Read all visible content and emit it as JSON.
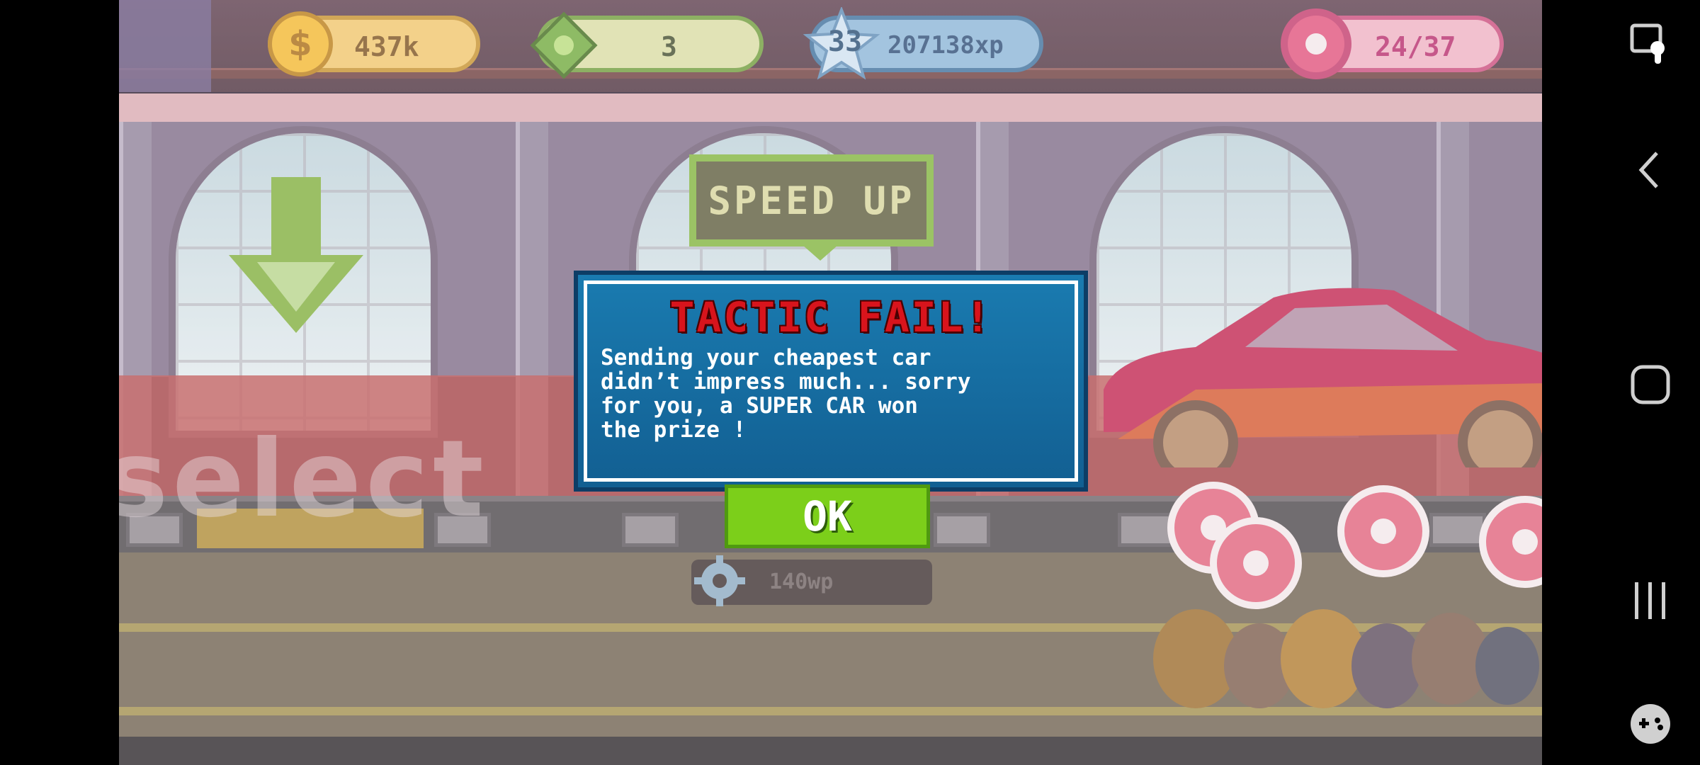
{
  "hud": {
    "coins": "437k",
    "cash": "3",
    "level": "33",
    "xp": "207138xp",
    "donuts": "24/37"
  },
  "background": {
    "sign_text": "SPEED UP",
    "watermark_text": "select",
    "work_points": "140wp"
  },
  "dialog": {
    "title": "TACTIC FAIL!",
    "message": "Sending your cheapest car\ndidn’t impress much... sorry\nfor you, a SUPER CAR won\nthe prize !",
    "ok_label": "OK"
  },
  "colors": {
    "dialog_bg": "#1a7bb0",
    "title_red": "#d8141c",
    "ok_green": "#7ccf1a"
  },
  "nav": {
    "icons": [
      "screenshot-touch-icon",
      "back-icon",
      "home-icon",
      "recents-icon",
      "game-launcher-icon"
    ]
  }
}
